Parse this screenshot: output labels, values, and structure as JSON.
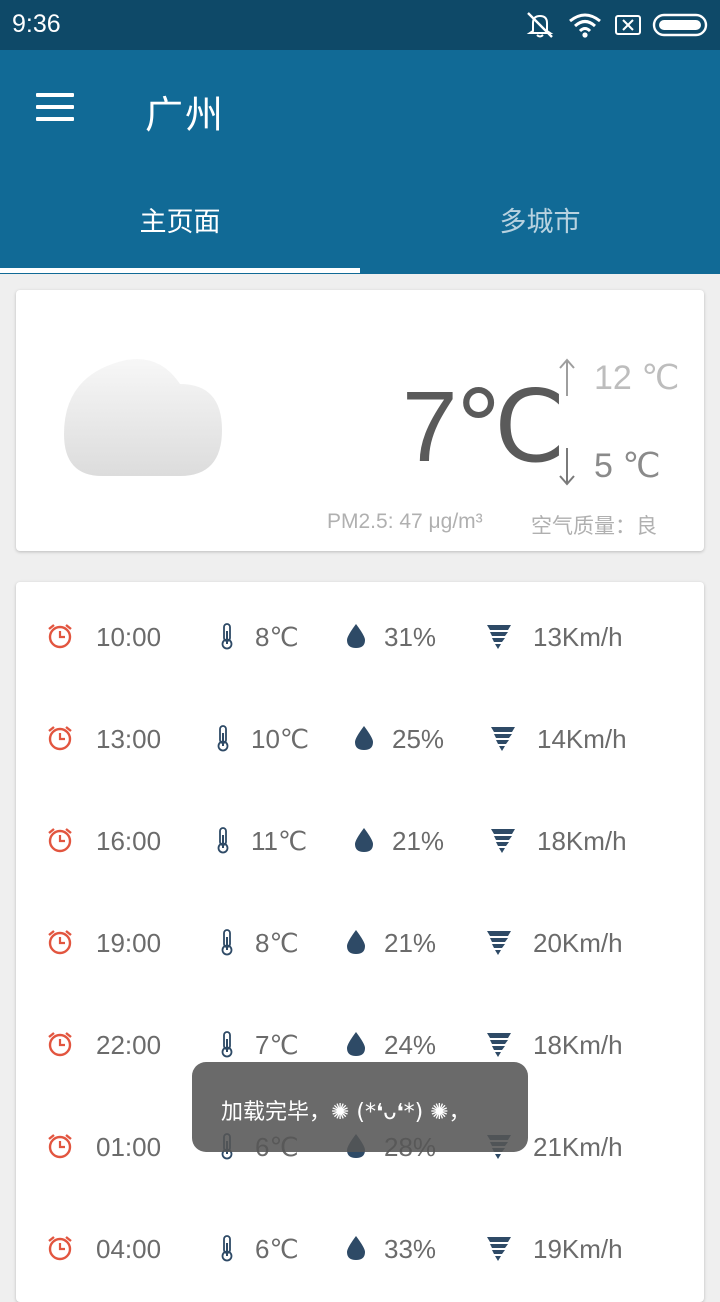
{
  "status_bar": {
    "time": "9:36",
    "icons": [
      "mute-icon",
      "wifi-icon",
      "sim-off-icon",
      "battery-icon"
    ]
  },
  "app_bar": {
    "city": "广州",
    "tabs": [
      {
        "label": "主页面"
      },
      {
        "label": "多城市"
      }
    ]
  },
  "current": {
    "icon": "cloud-icon",
    "temperature": "7℃",
    "high": "12 ℃",
    "low": "5 ℃",
    "pm25": "PM2.5: 47 μg/m³",
    "air_quality": "空气质量：良"
  },
  "hourly": [
    {
      "time": "10:00",
      "temp": "8℃",
      "humidity": "31%",
      "wind": "13Km/h"
    },
    {
      "time": "13:00",
      "temp": "10℃",
      "humidity": "25%",
      "wind": "14Km/h"
    },
    {
      "time": "16:00",
      "temp": "11℃",
      "humidity": "21%",
      "wind": "18Km/h"
    },
    {
      "time": "19:00",
      "temp": "8℃",
      "humidity": "21%",
      "wind": "20Km/h"
    },
    {
      "time": "22:00",
      "temp": "7℃",
      "humidity": "24%",
      "wind": "18Km/h"
    },
    {
      "time": "01:00",
      "temp": "6℃",
      "humidity": "28%",
      "wind": "21Km/h"
    },
    {
      "time": "04:00",
      "temp": "6℃",
      "humidity": "33%",
      "wind": "19Km/h"
    }
  ],
  "toast": {
    "message": "加载完毕，✺ (*❛ᴗ❛*) ✺，"
  },
  "colors": {
    "status_bar": "#0e4968",
    "app_bar": "#116a96",
    "alarm": "#e2553f",
    "icon_dark": "#2e4a66"
  }
}
